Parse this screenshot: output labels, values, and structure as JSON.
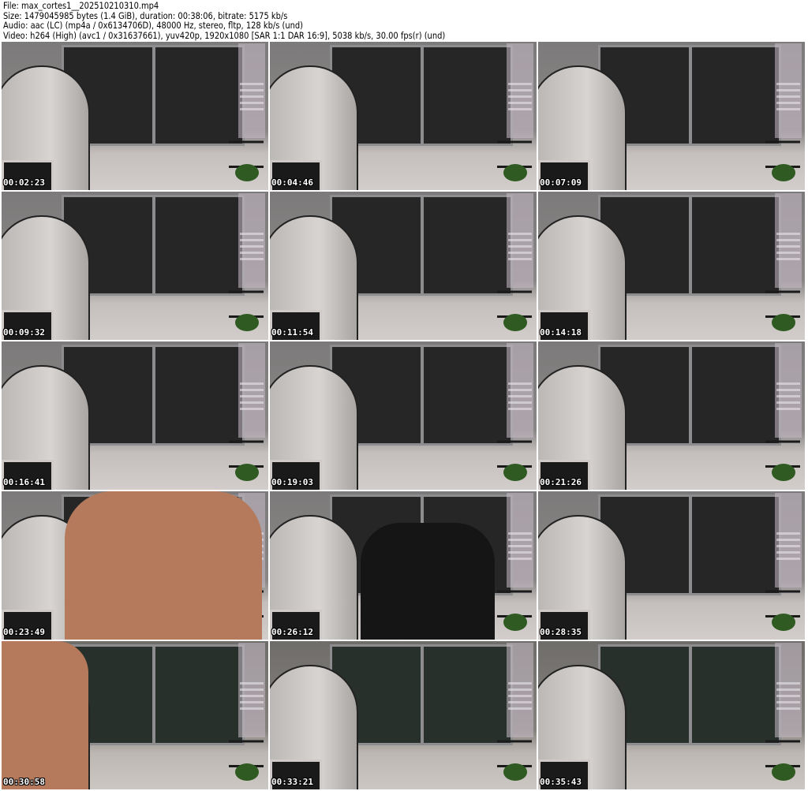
{
  "header": {
    "file": "File: max_cortes1__202510210310.mp4",
    "size": "Size: 1479045985 bytes (1.4 GiB), duration: 00:38:06, bitrate: 5175 kb/s",
    "audio": "Audio: aac (LC) (mp4a / 0x6134706D), 48000 Hz, stereo, fltp, 128 kb/s (und)",
    "video": "Video: h264 (High) (avc1 / 0x31637661), yuv420p, 1920x1080 [SAR 1:1 DAR 16:9], 5038 kb/s, 30.00 fps(r) (und)"
  },
  "thumbnails": [
    {
      "timestamp": "00:02:23",
      "scene": "room"
    },
    {
      "timestamp": "00:04:46",
      "scene": "room"
    },
    {
      "timestamp": "00:07:09",
      "scene": "room"
    },
    {
      "timestamp": "00:09:32",
      "scene": "room"
    },
    {
      "timestamp": "00:11:54",
      "scene": "room"
    },
    {
      "timestamp": "00:14:18",
      "scene": "room"
    },
    {
      "timestamp": "00:16:41",
      "scene": "room"
    },
    {
      "timestamp": "00:19:03",
      "scene": "room"
    },
    {
      "timestamp": "00:21:26",
      "scene": "room"
    },
    {
      "timestamp": "00:23:49",
      "scene": "person"
    },
    {
      "timestamp": "00:26:12",
      "scene": "chair"
    },
    {
      "timestamp": "00:28:35",
      "scene": "room"
    },
    {
      "timestamp": "00:30:58",
      "scene": "person-side"
    },
    {
      "timestamp": "00:33:21",
      "scene": "room-green"
    },
    {
      "timestamp": "00:35:43",
      "scene": "room-green"
    }
  ]
}
